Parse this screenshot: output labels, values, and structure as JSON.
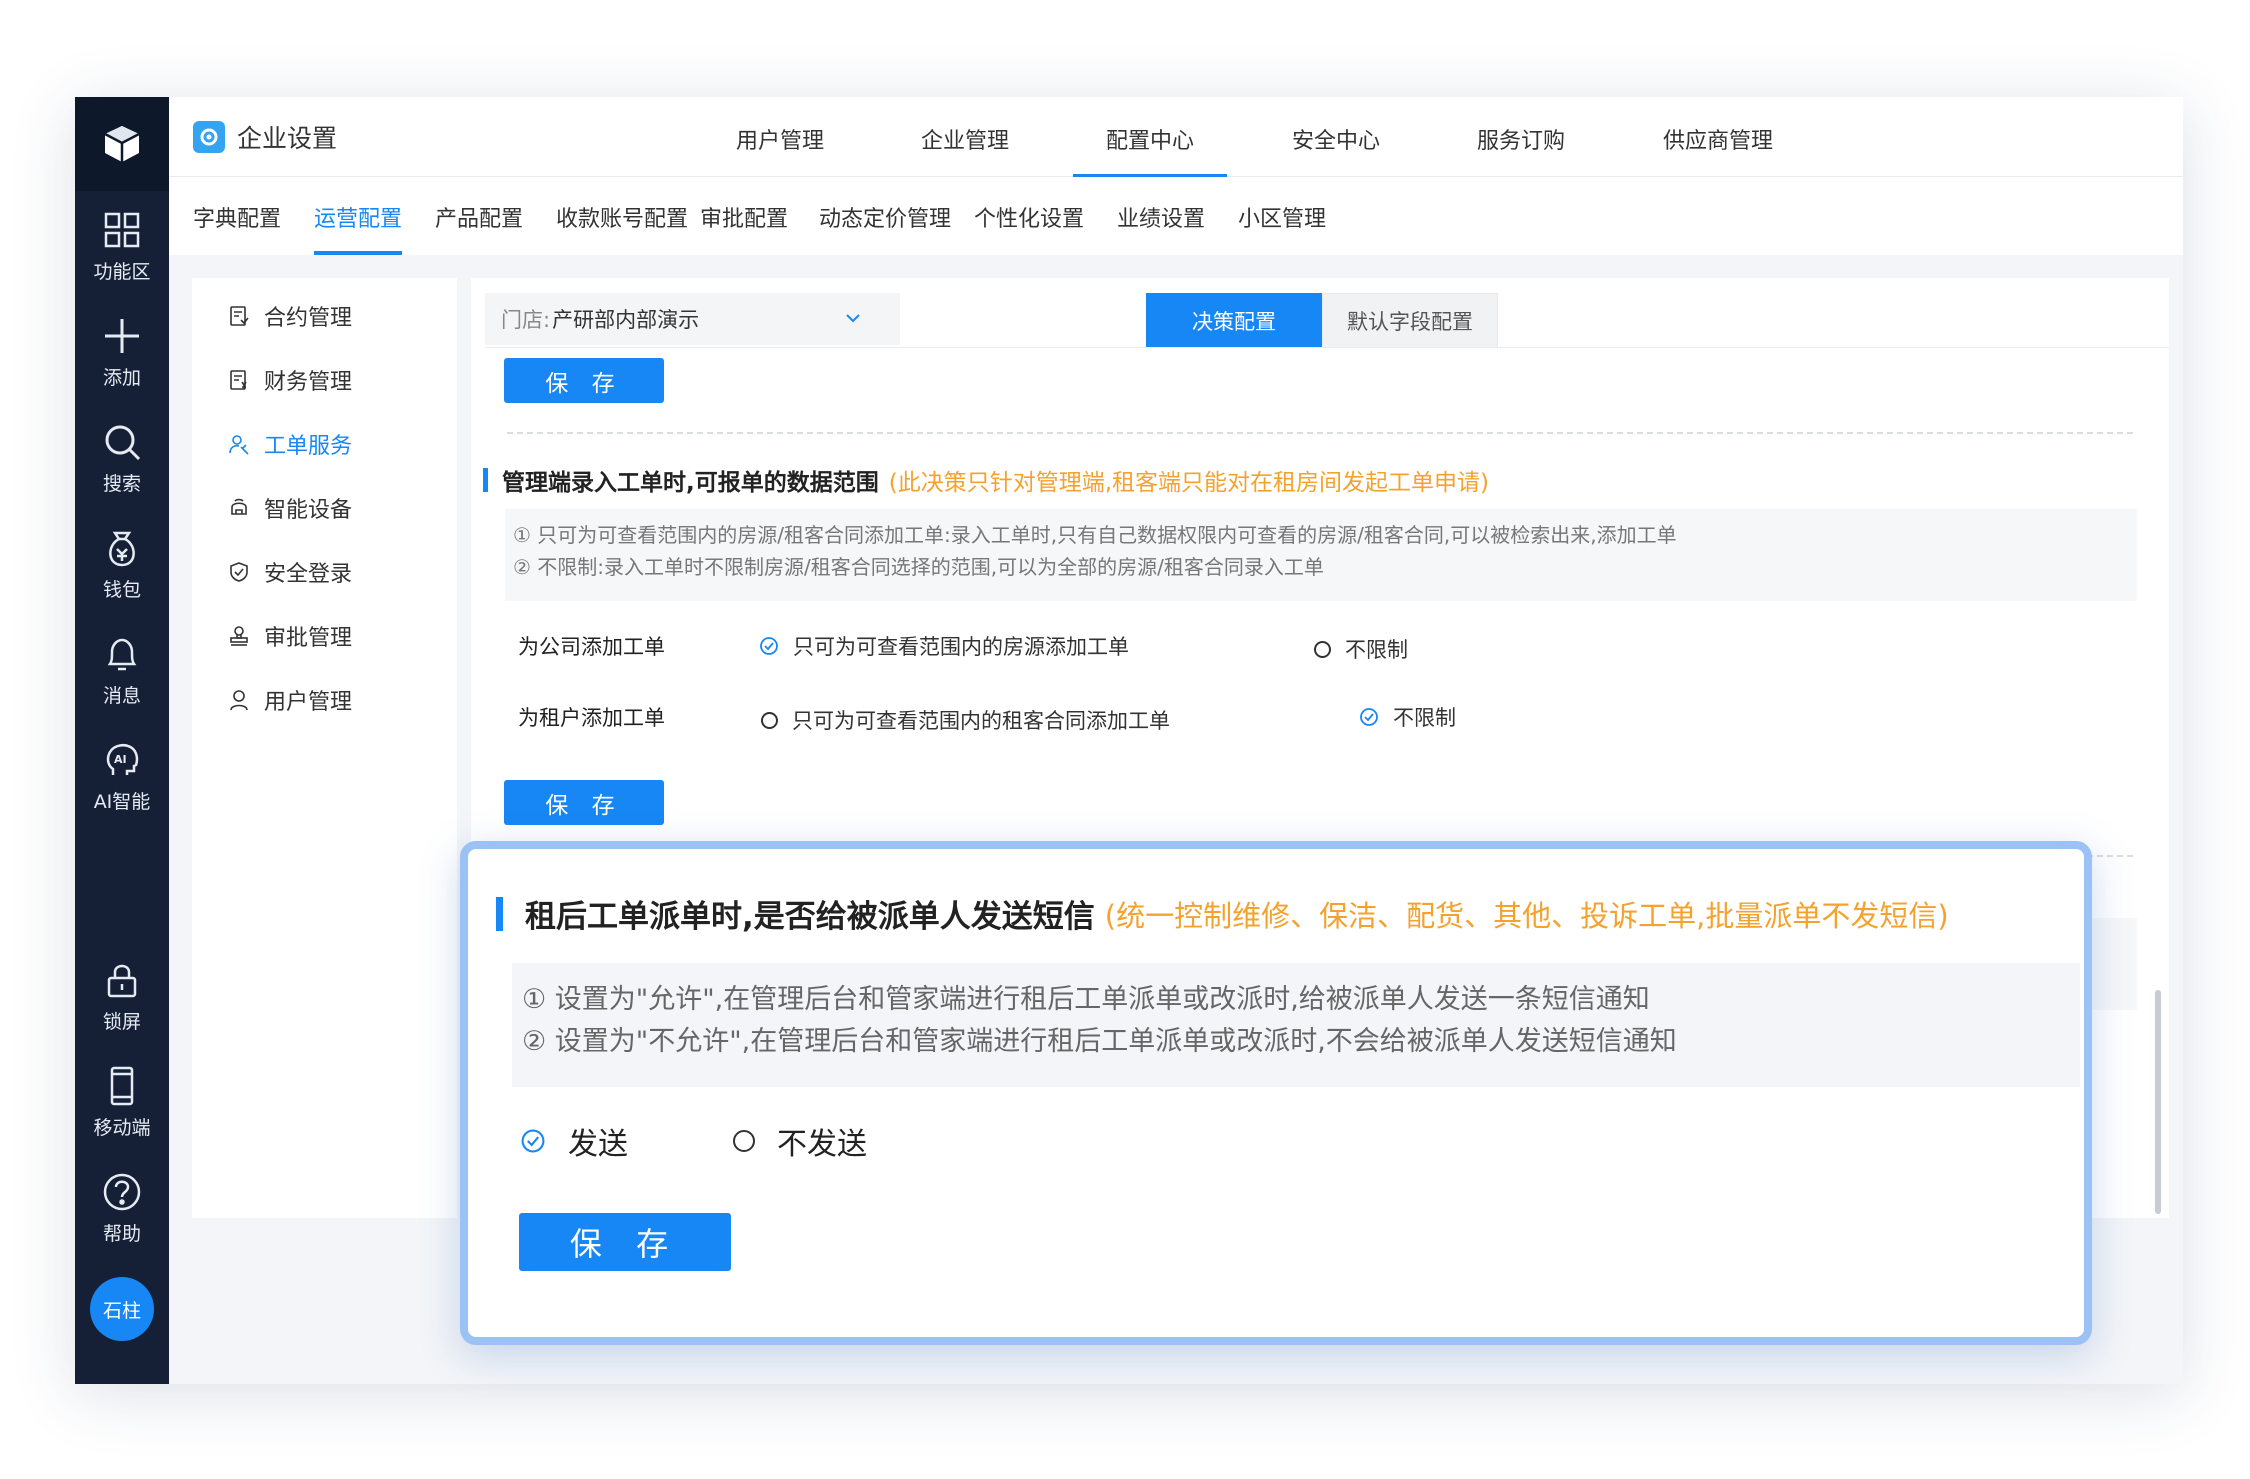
{
  "app": {
    "title": "企业设置"
  },
  "leftnav": {
    "items": [
      {
        "label": "功能区",
        "icon": "grid-icon"
      },
      {
        "label": "添加",
        "icon": "plus-icon"
      },
      {
        "label": "搜索",
        "icon": "search-icon"
      },
      {
        "label": "钱包",
        "icon": "wallet-icon"
      },
      {
        "label": "消息",
        "icon": "bell-icon"
      },
      {
        "label": "AI智能",
        "icon": "ai-icon"
      },
      {
        "label": "锁屏",
        "icon": "lock-icon"
      },
      {
        "label": "移动端",
        "icon": "mobile-icon"
      },
      {
        "label": "帮助",
        "icon": "help-icon"
      }
    ],
    "avatar": "石柱"
  },
  "topnav": {
    "items": [
      "用户管理",
      "企业管理",
      "配置中心",
      "安全中心",
      "服务订购",
      "供应商管理"
    ],
    "active": "配置中心"
  },
  "subtabs": {
    "items": [
      "字典配置",
      "运营配置",
      "产品配置",
      "收款账号配置",
      "审批配置",
      "动态定价管理",
      "个性化设置",
      "业绩设置",
      "小区管理"
    ],
    "active": "运营配置"
  },
  "sidemenu": {
    "items": [
      {
        "label": "合约管理",
        "icon": "contract-icon"
      },
      {
        "label": "财务管理",
        "icon": "finance-icon"
      },
      {
        "label": "工单服务",
        "icon": "service-icon"
      },
      {
        "label": "智能设备",
        "icon": "device-icon"
      },
      {
        "label": "安全登录",
        "icon": "shield-icon"
      },
      {
        "label": "审批管理",
        "icon": "stamp-icon"
      },
      {
        "label": "用户管理",
        "icon": "user-icon"
      }
    ],
    "active": "工单服务"
  },
  "main": {
    "store_label": "门店:",
    "store_value": "产研部内部演示",
    "tab_decision": "决策配置",
    "tab_default": "默认字段配置",
    "save_label": "保 存",
    "section1": {
      "title": "管理端录入工单时,可报单的数据范围",
      "note": "(此决策只针对管理端,租客端只能对在租房间发起工单申请)",
      "desc1": "① 只可为可查看范围内的房源/租客合同添加工单:录入工单时,只有自己数据权限内可查看的房源/租客合同,可以被检索出来,添加工单",
      "desc2": "② 不限制:录入工单时不限制房源/租客合同选择的范围,可以为全部的房源/租客合同录入工单",
      "row1_label": "为公司添加工单",
      "row1_opt1": "只可为可查看范围内的房源添加工单",
      "row1_opt2": "不限制",
      "row2_label": "为租户添加工单",
      "row2_opt1": "只可为可查看范围内的租客合同添加工单",
      "row2_opt2": "不限制"
    }
  },
  "popup": {
    "title": "租后工单派单时,是否给被派单人发送短信",
    "note": "(统一控制维修、保洁、配货、其他、投诉工单,批量派单不发短信)",
    "desc1": "① 设置为\"允许\",在管理后台和管家端进行租后工单派单或改派时,给被派单人发送一条短信通知",
    "desc2": "② 设置为\"不允许\",在管理后台和管家端进行租后工单派单或改派时,不会给被派单人发送短信通知",
    "opt_send": "发送",
    "opt_nosend": "不发送",
    "save_label": "保 存"
  },
  "colors": {
    "accent": "#1787f5",
    "nav_bg": "#152036",
    "note": "#f5a22d",
    "popup_border": "#9cc2f5"
  }
}
